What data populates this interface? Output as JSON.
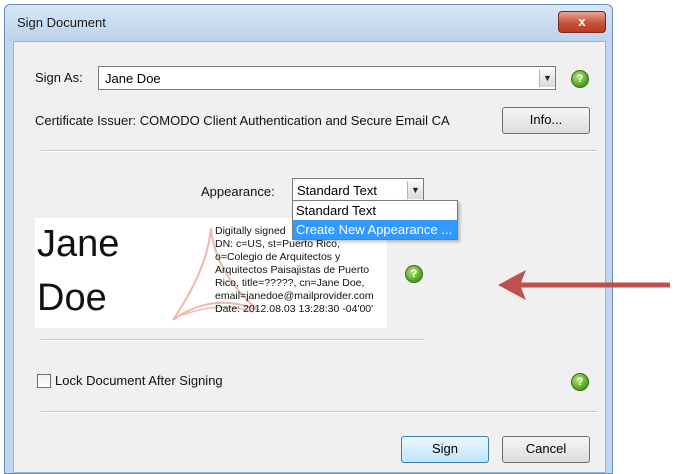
{
  "window": {
    "title": "Sign Document",
    "close_label": "x"
  },
  "sign_as": {
    "label": "Sign As:",
    "value": "Jane Doe"
  },
  "certificate": {
    "issuer_text": "Certificate Issuer: COMODO Client Authentication and Secure Email CA",
    "info_button": "Info..."
  },
  "appearance": {
    "label": "Appearance:",
    "value": "Standard Text",
    "options": [
      "Standard Text",
      "Create New Appearance ..."
    ]
  },
  "signature_preview": {
    "name_line1": "Jane",
    "name_line2": "Doe",
    "detail_lines": [
      "Digitally signed",
      "DN: c=US, st=Puerto Rico,",
      "o=Colegio de Arquitectos y",
      "Arquitectos Paisajistas de Puerto",
      "Rico, title=?????, cn=Jane  Doe,",
      "email=janedoe@mailprovider.com",
      "Date: 2012.08.03 13:28:30 -04'00'"
    ]
  },
  "lock": {
    "label": "Lock Document After Signing"
  },
  "buttons": {
    "sign": "Sign",
    "cancel": "Cancel"
  },
  "help_icon_glyph": "?",
  "colors": {
    "arrow": "#c0504d",
    "selection": "#3399ff",
    "help_icon": "#5aa52a"
  }
}
